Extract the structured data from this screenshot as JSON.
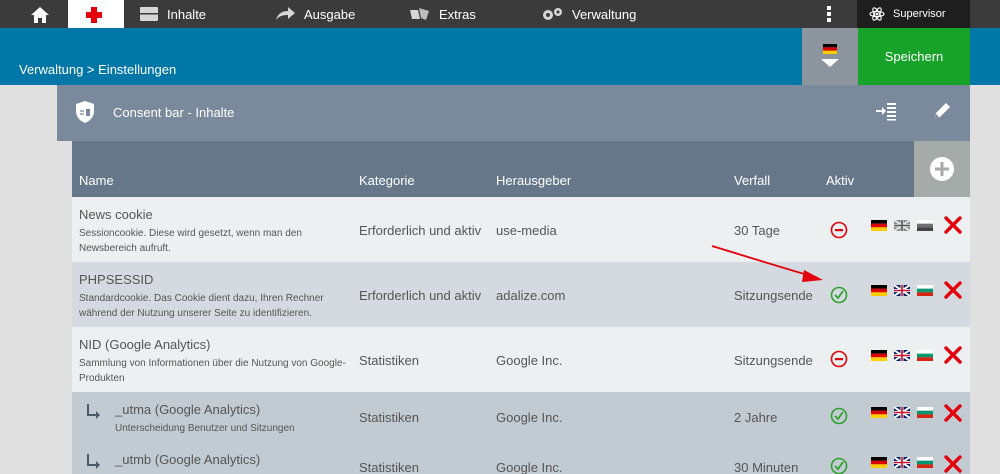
{
  "nav": {
    "items": [
      {
        "label": "Inhalte",
        "icon": "content-icon"
      },
      {
        "label": "Ausgabe",
        "icon": "share-arrow-icon"
      },
      {
        "label": "Extras",
        "icon": "extras-icon"
      },
      {
        "label": "Verwaltung",
        "icon": "gears-icon"
      }
    ],
    "user": "Supervisor"
  },
  "breadcrumb": "Verwaltung > Einstellungen",
  "save_label": "Speichern",
  "panel": {
    "title": "Consent bar - Inhalte"
  },
  "table": {
    "headers": [
      "Name",
      "Kategorie",
      "Herausgeber",
      "Verfall",
      "Aktiv"
    ],
    "rows": [
      {
        "name": "News cookie",
        "desc": "Sessioncookie. Diese wird gesetzt, wenn man den Newsbereich aufruft.",
        "kategorie": "Erforderlich und aktiv",
        "herausgeber": "use-media",
        "verfall": "30 Tage",
        "aktiv": "inactive",
        "child": false
      },
      {
        "name": "PHPSESSID",
        "desc": "Standardcookie. Das Cookie dient dazu, Ihren Rechner während der Nutzung unserer Seite zu identifizieren.",
        "kategorie": "Erforderlich und aktiv",
        "herausgeber": "adalize.com",
        "verfall": "Sitzungsende",
        "aktiv": "active",
        "child": false
      },
      {
        "name": "NID (Google Analytics)",
        "desc": "Sammlung von Informationen über die Nutzung von Google-Produkten",
        "kategorie": "Statistiken",
        "herausgeber": "Google Inc.",
        "verfall": "Sitzungsende",
        "aktiv": "inactive",
        "child": false
      },
      {
        "name": "_utma (Google Analytics)",
        "desc": "Unterscheidung Benutzer und Sitzungen",
        "kategorie": "Statistiken",
        "herausgeber": "Google Inc.",
        "verfall": "2 Jahre",
        "aktiv": "active",
        "child": true
      },
      {
        "name": "_utmb (Google Analytics)",
        "desc": "",
        "kategorie": "Statistiken",
        "herausgeber": "Google Inc.",
        "verfall": "30 Minuten",
        "aktiv": "active",
        "child": true
      }
    ]
  },
  "colors": {
    "topnav": "#3b3b3b",
    "blue": "#0077a7",
    "save": "#17a329",
    "panel_header": "#7a8a9c",
    "table_head": "#66778a",
    "row_light": "#ecf0f1",
    "row_dark": "#d4dadf",
    "child_row": "#c3cbd2",
    "danger": "#e3000b",
    "ok": "#2ea02e"
  }
}
